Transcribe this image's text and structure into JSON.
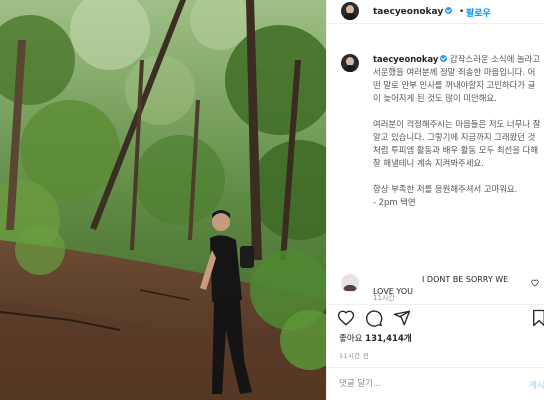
{
  "colors": {
    "accent": "#0095f6",
    "verified": "#3897f0",
    "muted": "#8e8e8e",
    "text": "#262626"
  },
  "header": {
    "username": "taecyeonokay",
    "separator": "•",
    "follow_label": "팔로우"
  },
  "caption": {
    "username": "taecyeonokay",
    "paragraph1": "갑작스러운 소식에 놀라고 서운했을 여러분께 정말 죄송한 마음입니다. 어떤 말로 안부 인사를 꺼내야할지 고민하다가 글이 늦어지게 된 것도 많이 미안해요.",
    "paragraph2": "여러분이 걱정해주시는 마음들은 저도 너무나 잘 알고 있습니다. 그렇기에 지금까지 그래왔던 것처럼 투피엠 활동과 배우 활동 모두 최선을 다해 잘 해낼테니 계속 지켜봐주세요.",
    "paragraph3": "항상 부족한 저를 응원해주셔서 고마워요.",
    "signature": "- 2pm 택연",
    "ago": "11시간"
  },
  "comment": {
    "username": "",
    "line1": "I DONT BE SORRY WE",
    "line2": "LOVE YOU"
  },
  "actions": {
    "icons": [
      "heart-icon",
      "comment-icon",
      "share-icon",
      "bookmark-icon"
    ]
  },
  "likes": {
    "prefix": "좋아요",
    "count": "131,414개"
  },
  "date": "11시간 전",
  "add_comment": {
    "placeholder": "댓글 달기...",
    "post_label": "게시"
  }
}
